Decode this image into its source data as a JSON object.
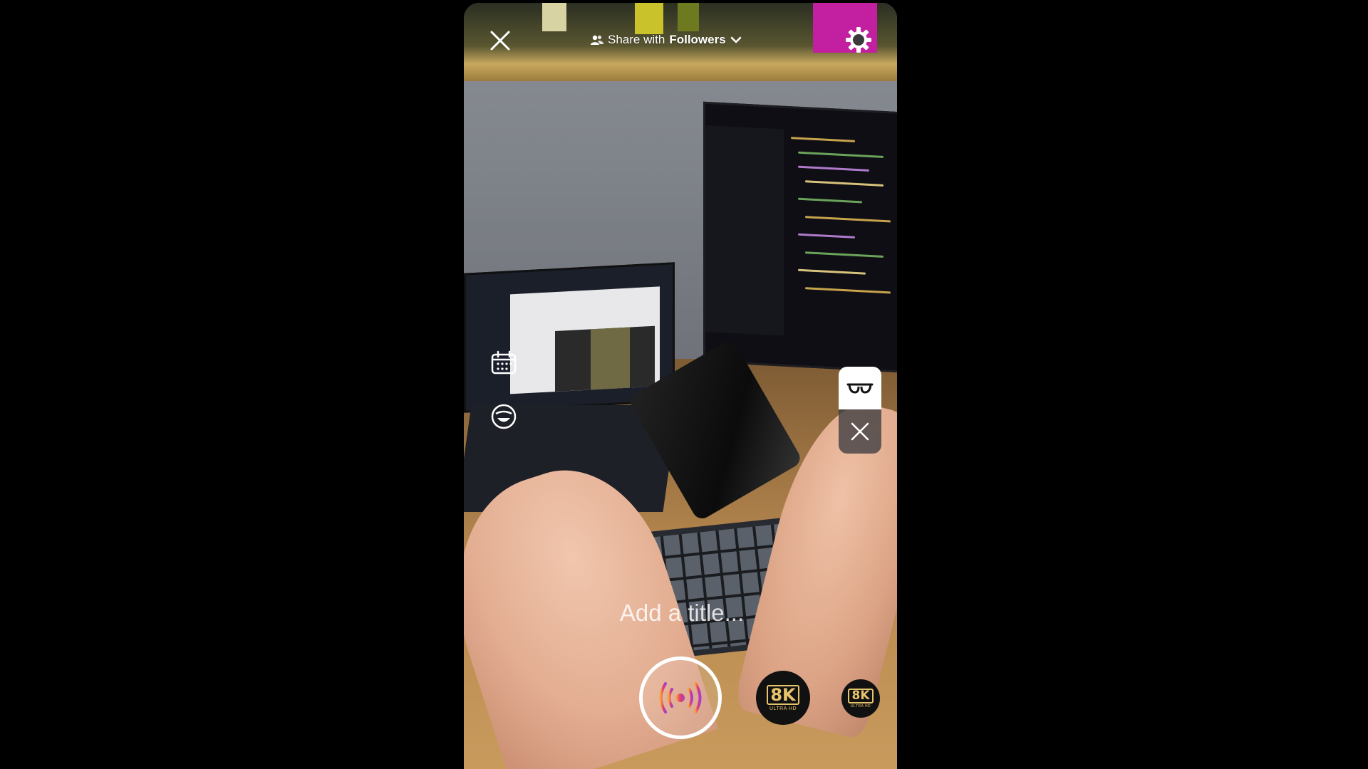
{
  "header": {
    "share_prefix": "Share with",
    "share_audience": "Followers",
    "icons": {
      "close": "close-icon",
      "audience": "people-icon",
      "dropdown": "chevron-down-icon",
      "settings": "gear-icon"
    }
  },
  "side_tools": {
    "icons": [
      "calendar-icon",
      "smiley-icon"
    ]
  },
  "glasses_prompt": {
    "icons": [
      "glasses-icon",
      "close-icon"
    ]
  },
  "title_field": {
    "placeholder": "Add a title..."
  },
  "bottom_bar": {
    "live_icon": "broadcast-icon",
    "effects": [
      {
        "big": "8K",
        "small": "ULTRA HD"
      },
      {
        "big": "8K",
        "small": "ULTRA HD"
      }
    ]
  },
  "colors": {
    "accent_gold": "#e7c46b",
    "live_gradient_start": "#f7a13b",
    "live_gradient_mid": "#e33b6a",
    "live_gradient_end": "#a63bd1"
  }
}
